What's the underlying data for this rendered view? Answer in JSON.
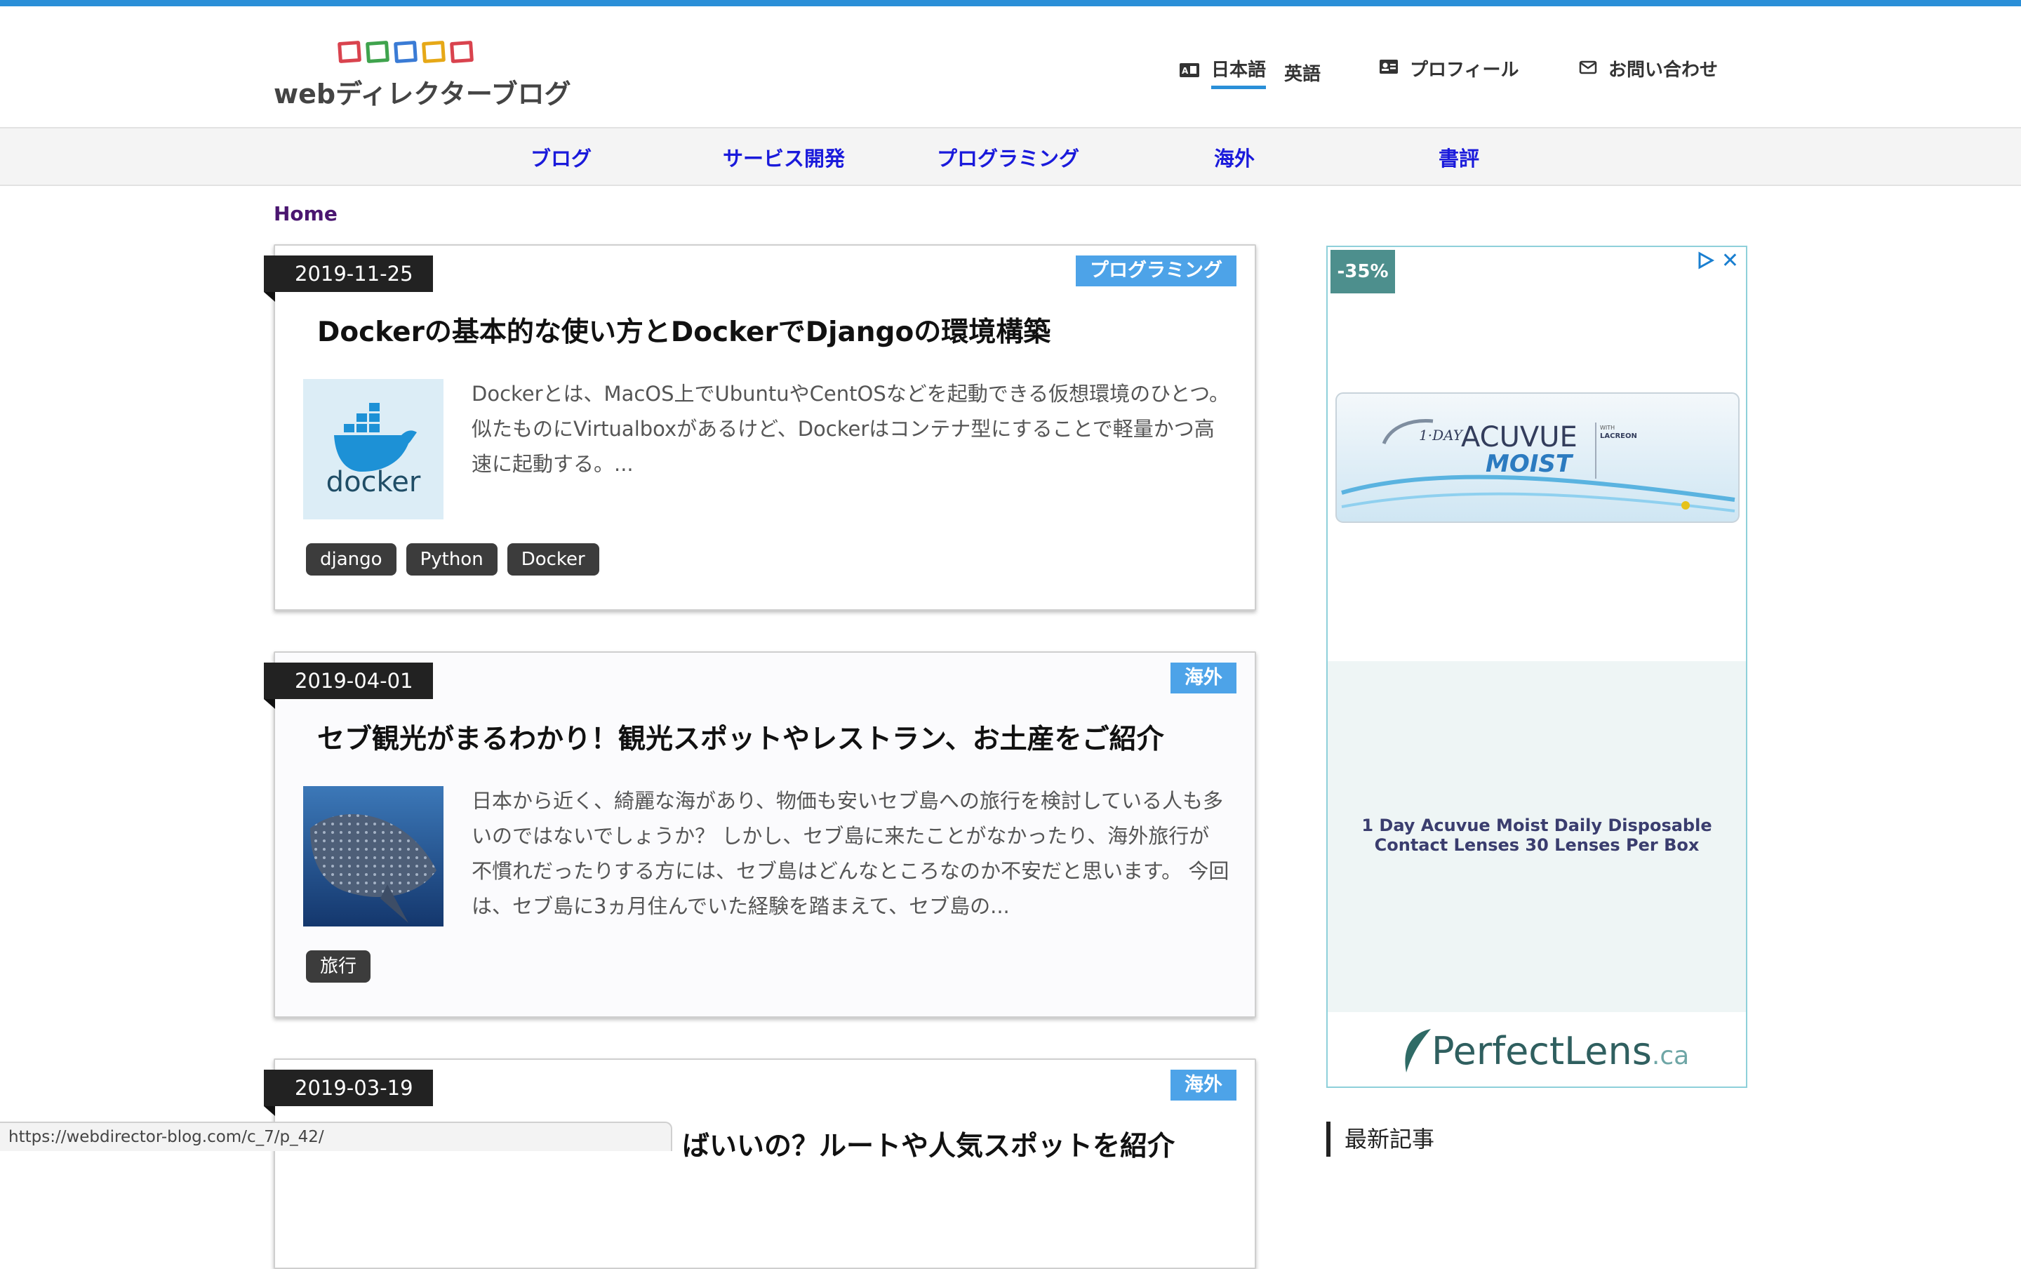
{
  "site": {
    "logo_text": "webディレクターブログ",
    "logo_colors": [
      "#d9434e",
      "#3fa34d",
      "#3a7bd5",
      "#e6a817",
      "#d9434e"
    ]
  },
  "topnav": {
    "lang_ja": "日本語",
    "lang_en": "英語",
    "profile": "プロフィール",
    "contact": "お問い合わせ"
  },
  "categories": [
    "ブログ",
    "サービス開発",
    "プログラミング",
    "海外",
    "書評"
  ],
  "breadcrumb": "Home",
  "posts": [
    {
      "date": "2019-11-25",
      "category": "プログラミング",
      "title": "Dockerの基本的な使い方とDockerでDjangoの環境構築",
      "excerpt": "Dockerとは、MacOS上でUbuntuやCentOSなどを起動できる仮想環境のひとつ。似たものにVirtualboxがあるけど、Dockerはコンテナ型にすることで軽量かつ高速に起動する。...",
      "thumb_label": "docker",
      "tags": [
        "django",
        "Python",
        "Docker"
      ]
    },
    {
      "date": "2019-04-01",
      "category": "海外",
      "title": "セブ観光がまるわかり！観光スポットやレストラン、お土産をご紹介",
      "excerpt": "日本から近く、綺麗な海があり、物価も安いセブ島への旅行を検討している人も多いのではないでしょうか？ しかし、セブ島に来たことがなかったり、海外旅行が不慣れだったりする方には、セブ島はどんなところなのか不安だと思います。 今回は、セブ島に3ヵ月住んでいた経験を踏まえて、セブ島の...",
      "tags": [
        "旅行"
      ]
    },
    {
      "date": "2019-03-19",
      "category": "海外",
      "title": "ばいいの？ルートや人気スポットを紹介"
    }
  ],
  "ad": {
    "discount": "-35%",
    "product_brand": "ACUVUE",
    "product_prefix": "1·DAY",
    "product_line": "MOIST",
    "product_with": "WITH",
    "product_lacreon": "LACREON",
    "caption": "1 Day Acuvue Moist Daily Disposable Contact Lenses 30 Lenses Per Box",
    "brand_main": "PerfectLens",
    "brand_suffix": ".ca"
  },
  "sidebar": {
    "recent_heading": "最新記事"
  },
  "status_url": "https://webdirector-blog.com/c_7/p_42/"
}
